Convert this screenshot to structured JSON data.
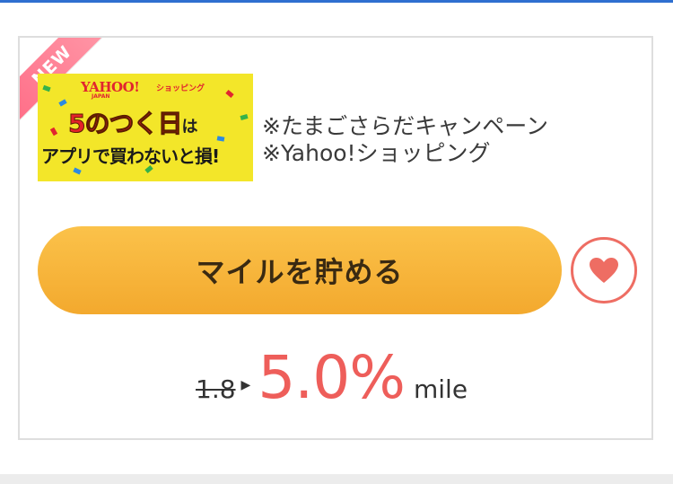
{
  "badge": {
    "label": "NEW"
  },
  "campaign": {
    "image": {
      "brand": "YAHOO!",
      "brand_sub": "JAPAN",
      "shop_label": "ショッピング",
      "line1": "5のつく日",
      "line1_suffix": "は",
      "line2": "アプリで買わないと損!"
    },
    "title_line1": "※たまごさらだキャンペーン",
    "title_line2": "※Yahoo!ショッピング"
  },
  "cta": {
    "label": "マイルを貯める"
  },
  "favorite": {
    "icon": "heart-icon",
    "color": "#ee6d63"
  },
  "rate": {
    "old_value": "1.8",
    "new_value": "5.0%",
    "unit": "mile",
    "accent_color": "#ee5e5a"
  }
}
